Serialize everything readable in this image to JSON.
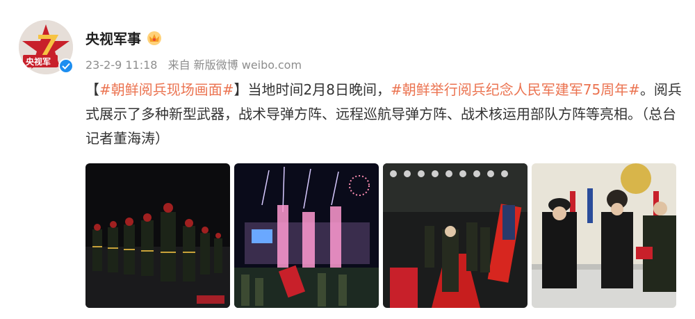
{
  "account": {
    "name": "央视军事",
    "avatar_text": "央视军"
  },
  "meta": {
    "time": "23-2-9 11:18",
    "source": "来自 新版微博 weibo.com"
  },
  "post": {
    "open_bracket": "【",
    "tag1": "#朝鲜阅兵现场画面#",
    "close_bracket": "】",
    "text1": "当地时间2月8日晚间，",
    "tag2": "#朝鲜举行阅兵纪念人民军建军75周年#",
    "text2": "。阅兵式展示了多种新型武器，战术导弹方阵、远程巡航导弹方阵、战术核运用部队方阵等亮相。（总台记者董海涛）"
  },
  "photos": [
    {
      "icon": "soldiers-marching-photo"
    },
    {
      "icon": "fireworks-square-photo"
    },
    {
      "icon": "flag-guard-walk-photo"
    },
    {
      "icon": "leaders-balcony-photo"
    }
  ],
  "colors": {
    "link": "#eb7350",
    "verified": "#1d8ef0",
    "meta": "#8d8d8d"
  }
}
